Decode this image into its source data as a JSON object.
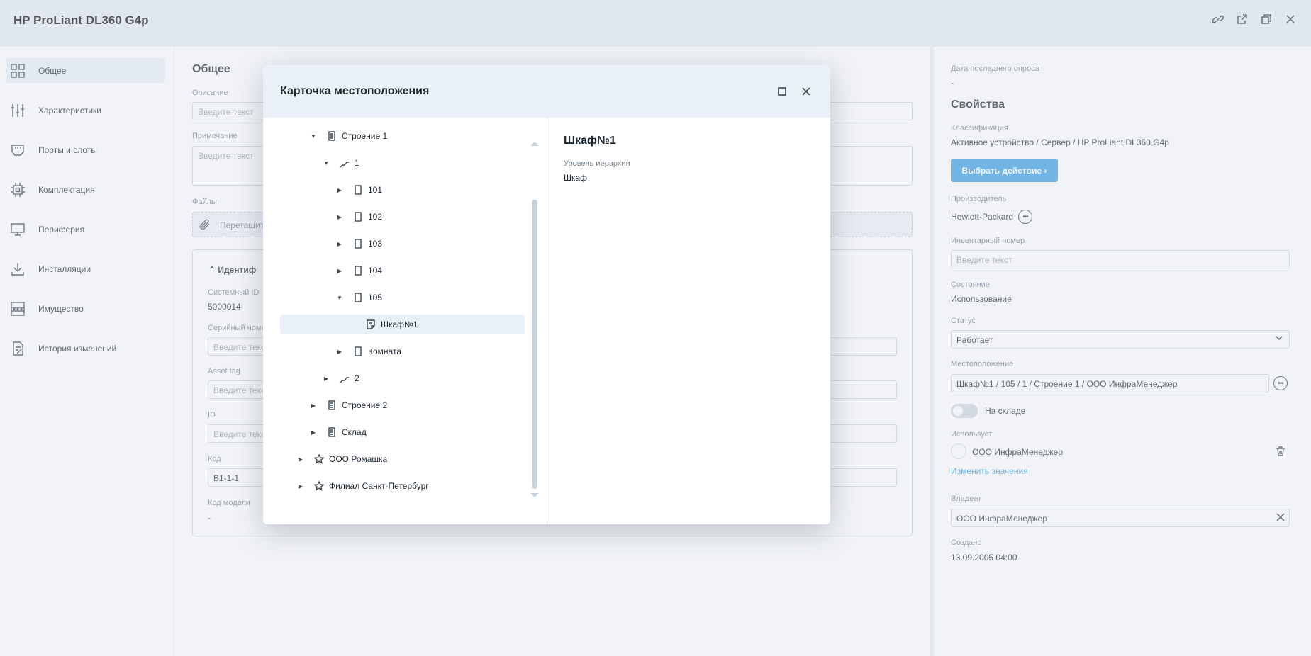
{
  "app": {
    "title": "HP ProLiant DL360 G4p",
    "header_icons": [
      "link-icon",
      "external-open-icon",
      "copy-window-icon",
      "close-icon"
    ]
  },
  "sidebar": {
    "items": [
      {
        "label": "Общее",
        "icon": "grid-icon",
        "active": true
      },
      {
        "label": "Характеристики",
        "icon": "sliders-icon"
      },
      {
        "label": "Порты и слоты",
        "icon": "port-icon"
      },
      {
        "label": "Комплектация",
        "icon": "chip-icon"
      },
      {
        "label": "Периферия",
        "icon": "monitor-icon"
      },
      {
        "label": "Инсталляции",
        "icon": "download-icon"
      },
      {
        "label": "Имущество",
        "icon": "inventory-icon"
      },
      {
        "label": "История изменений",
        "icon": "history-icon"
      }
    ],
    "collapse_glyph": "‹"
  },
  "main": {
    "title": "Общее",
    "description_label": "Описание",
    "description_placeholder": "Введите текст",
    "note_label": "Примечание",
    "note_placeholder": "Введите текст",
    "files_label": "Файлы",
    "files_drop_text": "Перетащите",
    "ident": {
      "title": "Идентиф",
      "system_id_label": "Системный ID",
      "system_id_value": "5000014",
      "serial_label": "Серийный номе",
      "serial_placeholder": "Введите текс",
      "asset_tag_label": "Asset tag",
      "asset_tag_placeholder": "Введите текс",
      "id_label": "ID",
      "id_placeholder": "Введите текс",
      "code_label": "Код",
      "code_value": "B1-1-1",
      "model_code_label": "Код модели",
      "model_code_value": "-"
    }
  },
  "right": {
    "last_poll_label": "Дата последнего опроса",
    "last_poll_value": "-",
    "section_title": "Свойства",
    "classification_label": "Классификация",
    "classification_value": "Активное устройство / Сервер / HP ProLiant DL360 G4p",
    "action_button": "Выбрать действие ›",
    "manufacturer_label": "Производитель",
    "manufacturer_value": "Hewlett-Packard",
    "inventory_label": "Инвентарный номер",
    "inventory_placeholder": "Введите текст",
    "state_label": "Состояние",
    "state_value": "Использование",
    "status_label": "Статус",
    "status_value": "Работает",
    "location_label": "Местоположение",
    "location_value": "Шкаф№1 / 105 / 1 / Строение 1 / ООО ИнфраМенеджер",
    "in_stock_label": "На складе",
    "used_by_label": "Использует",
    "used_by_value": "ООО ИнфраМенеджер",
    "change_link": "Изменить значения",
    "owner_label": "Владеет",
    "owner_value": "ООО ИнфраМенеджер",
    "created_label": "Создано",
    "created_value": "13.09.2005 04:00"
  },
  "modal": {
    "title": "Карточка местоположения",
    "tree": [
      {
        "label": "Строение 1",
        "icon": "building-icon",
        "caret": "▼"
      },
      {
        "label": "1",
        "icon": "stairs-icon",
        "caret": "▼"
      },
      {
        "label": "101",
        "icon": "door-icon",
        "caret": "▶"
      },
      {
        "label": "102",
        "icon": "door-icon",
        "caret": "▶"
      },
      {
        "label": "103",
        "icon": "door-icon",
        "caret": "▶"
      },
      {
        "label": "104",
        "icon": "door-icon",
        "caret": "▶"
      },
      {
        "label": "105",
        "icon": "door-icon",
        "caret": "▼"
      },
      {
        "label": "Шкаф№1",
        "icon": "rack-icon",
        "caret": ""
      },
      {
        "label": "Комната",
        "icon": "door-icon",
        "caret": "▶"
      },
      {
        "label": "2",
        "icon": "stairs-icon",
        "caret": "▶"
      },
      {
        "label": "Строение 2",
        "icon": "building-icon",
        "caret": "▶"
      },
      {
        "label": "Склад",
        "icon": "building-icon",
        "caret": "▶"
      },
      {
        "label": "ООО Ромашка",
        "icon": "star-icon",
        "caret": "▶"
      },
      {
        "label": "Филиал Санкт-Петербург",
        "icon": "star-icon",
        "caret": "▶"
      }
    ],
    "detail": {
      "title": "Шкаф№1",
      "level_label": "Уровень иерархии",
      "level_value": "Шкаф"
    }
  }
}
